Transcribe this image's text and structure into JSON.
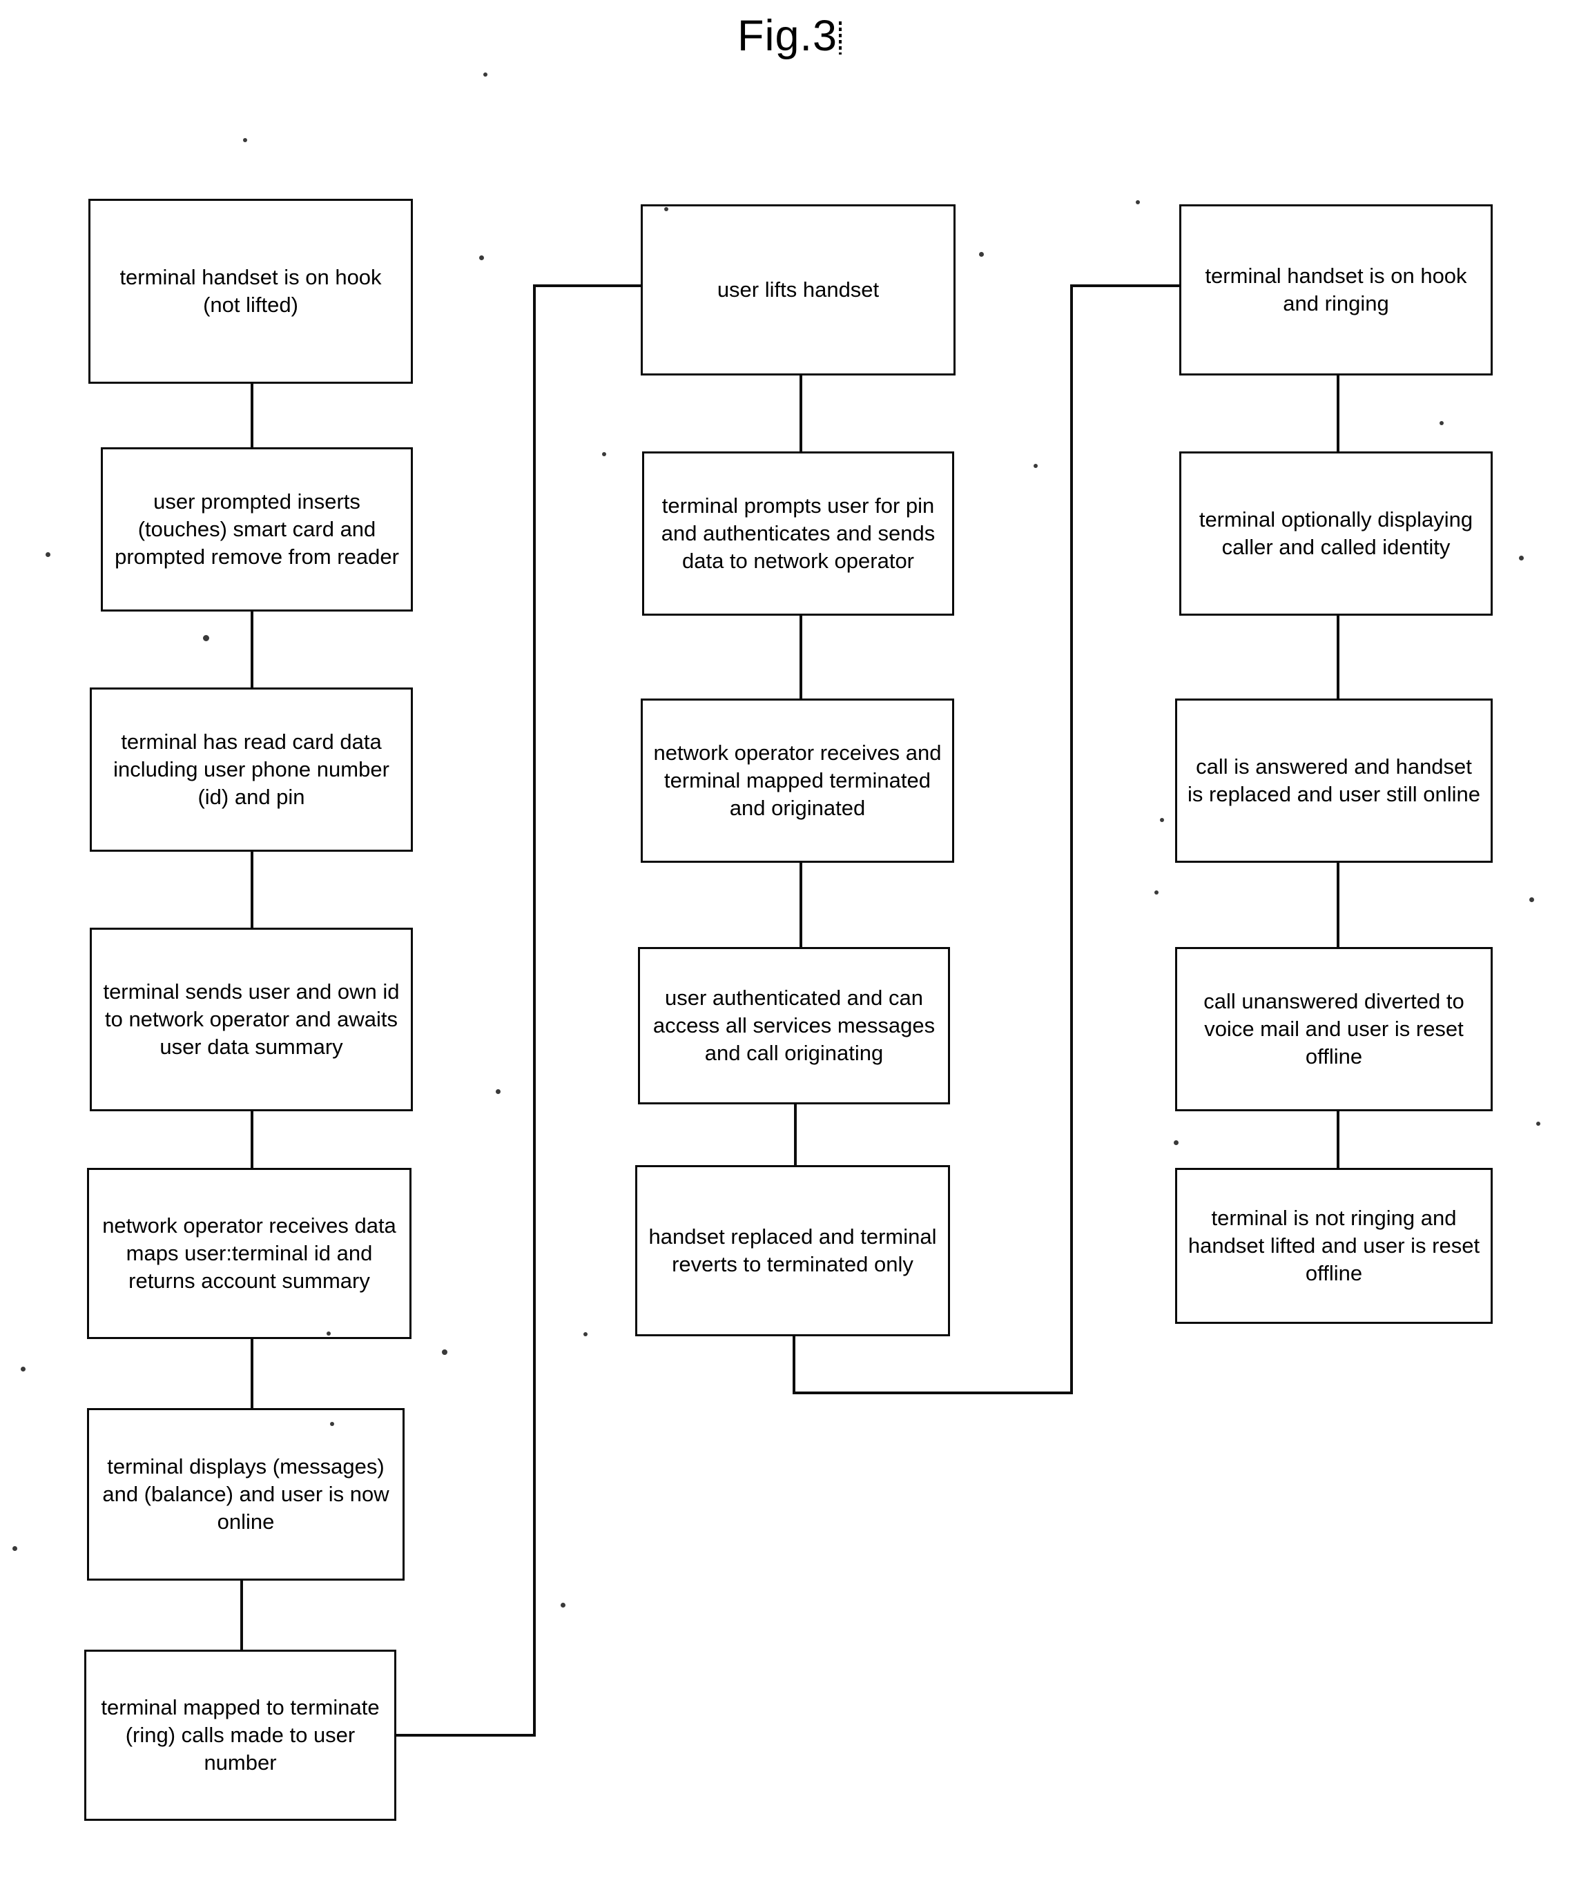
{
  "figure": {
    "title": "Fig.3",
    "type": "flowchart",
    "background": "#ffffff",
    "line_color": "#0a0a0a"
  },
  "columns": [
    {
      "id": "column-1",
      "name": "smart-card-logon-flow",
      "nodes": [
        {
          "id": "c1n1",
          "text": "terminal handset is on hook (not lifted)"
        },
        {
          "id": "c1n2",
          "text": "user prompted inserts (touches) smart card and prompted remove from reader"
        },
        {
          "id": "c1n3",
          "text": "terminal has read card data including user phone number (id) and pin"
        },
        {
          "id": "c1n4",
          "text": "terminal sends user and own id to network operator and awaits user data summary"
        },
        {
          "id": "c1n5",
          "text": "network operator receives data maps user:terminal id and returns account summary"
        },
        {
          "id": "c1n6",
          "text": "terminal displays (messages) and (balance) and user is now online"
        },
        {
          "id": "c1n7",
          "text": "terminal mapped to terminate (ring) calls made to user number"
        }
      ]
    },
    {
      "id": "column-2",
      "name": "originating-call-flow",
      "nodes": [
        {
          "id": "c2n1",
          "text": "user lifts handset"
        },
        {
          "id": "c2n2",
          "text": "terminal prompts user for pin and authenticates and sends data to network operator"
        },
        {
          "id": "c2n3",
          "text": "network operator receives and terminal mapped terminated and originated"
        },
        {
          "id": "c2n4",
          "text": "user authenticated and can access all services messages and call originating"
        },
        {
          "id": "c2n5",
          "text": "handset replaced and terminal reverts to terminated only"
        }
      ]
    },
    {
      "id": "column-3",
      "name": "terminating-call-flow",
      "nodes": [
        {
          "id": "c3n1",
          "text": "terminal handset is on hook and ringing"
        },
        {
          "id": "c3n2",
          "text": "terminal optionally displaying caller and called identity"
        },
        {
          "id": "c3n3",
          "text": "call is answered and handset is replaced and user still online"
        },
        {
          "id": "c3n4",
          "text": "call unanswered diverted to voice mail and user is reset offline"
        },
        {
          "id": "c3n5",
          "text": "terminal is not ringing and handset lifted and user is reset offline"
        }
      ]
    }
  ],
  "connections": [
    {
      "id": "e1",
      "from": "c1n1",
      "to": "c1n2",
      "kind": "vertical"
    },
    {
      "id": "e2",
      "from": "c1n2",
      "to": "c1n3",
      "kind": "vertical"
    },
    {
      "id": "e3",
      "from": "c1n3",
      "to": "c1n4",
      "kind": "vertical"
    },
    {
      "id": "e4",
      "from": "c1n4",
      "to": "c1n5",
      "kind": "vertical"
    },
    {
      "id": "e5",
      "from": "c1n5",
      "to": "c1n6",
      "kind": "vertical"
    },
    {
      "id": "e6",
      "from": "c1n6",
      "to": "c1n7",
      "kind": "vertical"
    },
    {
      "id": "e7",
      "from": "c1n7",
      "to": "c2n1",
      "kind": "routed-feedback"
    },
    {
      "id": "e8",
      "from": "c2n1",
      "to": "c2n2",
      "kind": "vertical"
    },
    {
      "id": "e9",
      "from": "c2n2",
      "to": "c2n3",
      "kind": "vertical"
    },
    {
      "id": "e10",
      "from": "c2n3",
      "to": "c2n4",
      "kind": "vertical"
    },
    {
      "id": "e11",
      "from": "c2n4",
      "to": "c2n5",
      "kind": "vertical"
    },
    {
      "id": "e12",
      "from": "c2n5",
      "to": "c3n1",
      "kind": "routed-feedback"
    },
    {
      "id": "e13",
      "from": "c3n1",
      "to": "c3n2",
      "kind": "vertical"
    },
    {
      "id": "e14",
      "from": "c3n2",
      "to": "c3n3",
      "kind": "vertical"
    },
    {
      "id": "e15",
      "from": "c3n3",
      "to": "c3n4",
      "kind": "vertical"
    },
    {
      "id": "e16",
      "from": "c3n4",
      "to": "c3n5",
      "kind": "vertical"
    }
  ]
}
